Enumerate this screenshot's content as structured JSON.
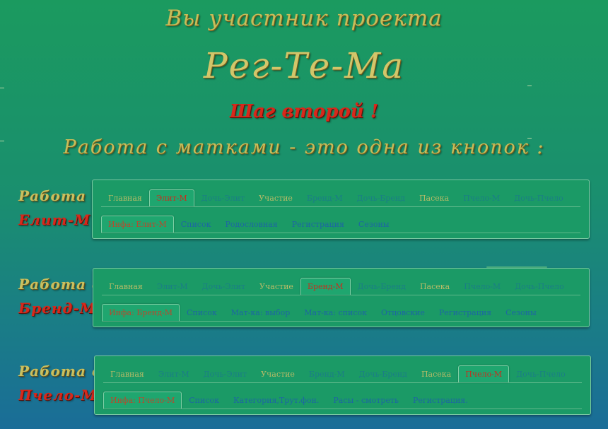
{
  "header": {
    "line1": "Вы участник проекта",
    "line2": "Рег-Те-Ма",
    "line3": "Шаг второй !",
    "line4": "Работа с матками - это одна из кнопок :"
  },
  "sections": [
    {
      "label1": "Работа с",
      "label2": "Елит-М",
      "tabs": [
        {
          "label": "Главная",
          "color": "olive"
        },
        {
          "label": "Элит-М",
          "active": true
        },
        {
          "label": "Дочь-Элит",
          "color": "teal"
        },
        {
          "label": "Участие",
          "color": "olive"
        },
        {
          "label": "Бренд-М",
          "color": "teal"
        },
        {
          "label": "Дочь-Бренд",
          "color": "teal"
        },
        {
          "label": "Пасека",
          "color": "olive"
        },
        {
          "label": "Пчело-М",
          "color": "teal"
        },
        {
          "label": "Дочь-Пчело",
          "color": "teal"
        }
      ],
      "subtabs": [
        {
          "label": "Инфа: Елит-М",
          "active": true
        },
        {
          "label": "Список",
          "color": "blue"
        },
        {
          "label": "Родословная",
          "color": "blue"
        },
        {
          "label": "Регистрация",
          "color": "blue"
        },
        {
          "label": "Сезоны",
          "color": "blue"
        }
      ]
    },
    {
      "label1": "Работа с",
      "label2": "Бренд-М",
      "tabs": [
        {
          "label": "Главная",
          "color": "olive"
        },
        {
          "label": "Элит-М",
          "color": "teal"
        },
        {
          "label": "Дочь-Элит",
          "color": "teal"
        },
        {
          "label": "Участие",
          "color": "olive"
        },
        {
          "label": "Бренд-М",
          "active": true
        },
        {
          "label": "Дочь-Бренд",
          "color": "teal"
        },
        {
          "label": "Пасека",
          "color": "olive"
        },
        {
          "label": "Пчело-М",
          "color": "teal"
        },
        {
          "label": "Дочь-Пчело",
          "color": "teal"
        }
      ],
      "subtabs": [
        {
          "label": "Инфа: Бренд-М",
          "active": true
        },
        {
          "label": "Список",
          "color": "blue"
        },
        {
          "label": "Мат-ка: выбор",
          "color": "blue"
        },
        {
          "label": "Мат-ка: список",
          "color": "blue"
        },
        {
          "label": "Отцовские",
          "color": "blue"
        },
        {
          "label": "Регистрация",
          "color": "blue"
        },
        {
          "label": "Сезоны",
          "color": "blue"
        }
      ]
    },
    {
      "label1": "Работа с",
      "label2": "Пчело-М",
      "tabs": [
        {
          "label": "Главная",
          "color": "olive"
        },
        {
          "label": "Элит-М",
          "color": "teal"
        },
        {
          "label": "Дочь-Элит",
          "color": "teal"
        },
        {
          "label": "Участие",
          "color": "olive"
        },
        {
          "label": "Бренд-М",
          "color": "teal"
        },
        {
          "label": "Дочь-Бренд",
          "color": "teal"
        },
        {
          "label": "Пасека",
          "color": "olive"
        },
        {
          "label": "Пчело-М",
          "active": true
        },
        {
          "label": "Дочь-Пчело",
          "color": "teal"
        }
      ],
      "subtabs": [
        {
          "label": "Инфа: Пчело-М",
          "active": true
        },
        {
          "label": "Список",
          "color": "blue"
        },
        {
          "label": "Категория,Трут.фон.",
          "color": "blue"
        },
        {
          "label": "Расы - смотреть",
          "color": "blue"
        },
        {
          "label": "Регистрация.",
          "color": "blue"
        }
      ]
    }
  ],
  "colors": {
    "accent_red": "#d8281b",
    "gold": "#c8c060",
    "panel_bg": "#1b9a66"
  }
}
